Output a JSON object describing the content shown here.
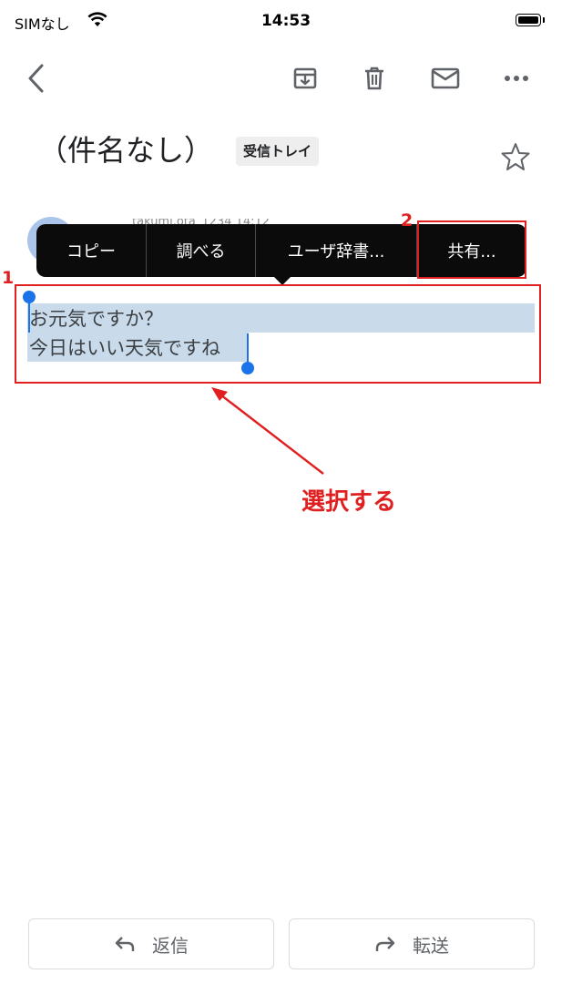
{
  "status_bar": {
    "carrier": "SIMなし",
    "time": "14:53"
  },
  "toolbar": {
    "back": "back",
    "archive": "archive",
    "delete": "delete",
    "mail": "mark-unread",
    "more": "more"
  },
  "subject": "（件名なし）",
  "label_chip": "受信トレイ",
  "sender_hint": "takumi.ota_1234 14:12",
  "context_menu": [
    "コピー",
    "調べる",
    "ユーザ辞書...",
    "共有..."
  ],
  "body_lines": [
    "お元気ですか？",
    "今日はいい天気ですね"
  ],
  "annotations": {
    "n1": "1",
    "n2": "2",
    "select_text": "選択する",
    "color": "#e02020"
  },
  "buttons": {
    "reply": "返信",
    "forward": "転送"
  },
  "colors": {
    "selection": "#c9daeb",
    "handle": "#1a73e8",
    "avatar": "#aac4ea"
  }
}
